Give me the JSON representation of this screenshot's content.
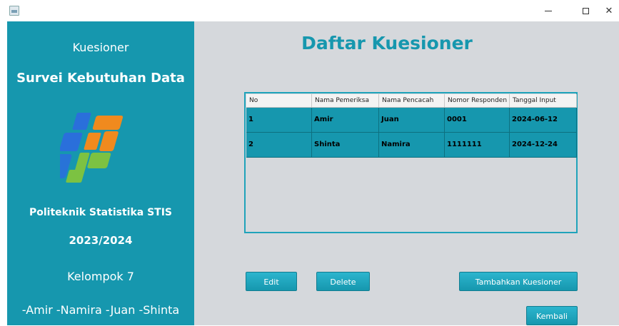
{
  "window": {
    "minimize_symbol": "–",
    "maximize_symbol": "☐",
    "close_symbol": "✕"
  },
  "sidebar": {
    "kuesioner": "Kuesioner",
    "survey_title": "Survei Kebutuhan Data",
    "institution": "Politeknik Statistika STIS",
    "year": "2023/2024",
    "group": "Kelompok 7",
    "members": "-Amir  -Namira  -Juan  -Shinta",
    "logo_colors": {
      "blue": "#2a6fdb",
      "orange": "#f08a1e",
      "green": "#7cc242"
    }
  },
  "main": {
    "title": "Daftar Kuesioner"
  },
  "table": {
    "columns": [
      "No",
      "Nama Pemeriksa",
      "Nama Pencacah",
      "Nomor Responden",
      "Tanggal Input"
    ],
    "rows": [
      [
        "1",
        "Amir",
        "Juan",
        "0001",
        "2024-06-12"
      ],
      [
        "2",
        "Shinta",
        "Namira",
        "1111111",
        "2024-12-24"
      ]
    ]
  },
  "buttons": {
    "edit": "Edit",
    "delete": "Delete",
    "tambah": "Tambahkan Kuesioner",
    "kembali": "Kembali"
  },
  "colors": {
    "accent": "#1697ae",
    "main_bg": "#d5d8dc"
  }
}
